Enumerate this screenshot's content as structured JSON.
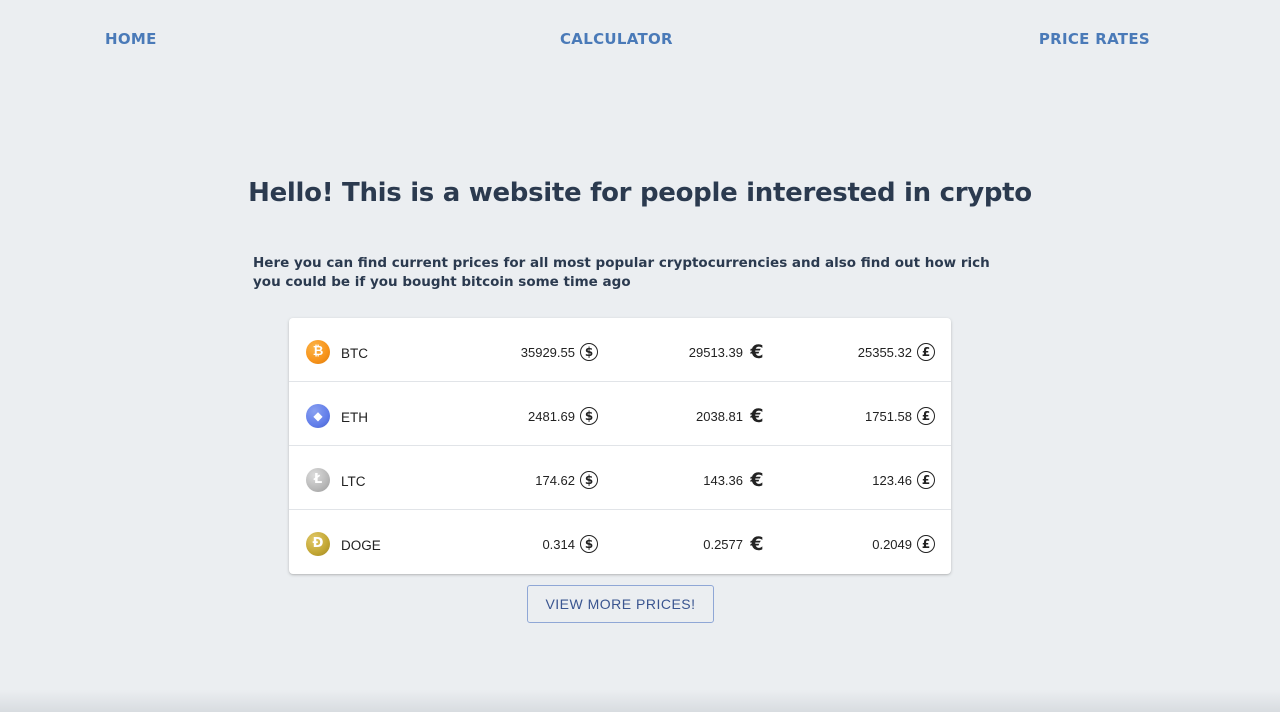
{
  "nav": {
    "home": "HOME",
    "calculator": "CALCULATOR",
    "price_rates": "PRICE RATES",
    "link_color": "#4a7ab8"
  },
  "main": {
    "headline": "Hello! This is a website for people interested in crypto",
    "intro": "Here you can find current prices for all most popular cryptocurrencies and also find out how rich you could be if you bought bitcoin some time ago"
  },
  "prices": {
    "rows": [
      {
        "symbol": "BTC",
        "icon": "bitcoin-icon",
        "icon_glyph": "₿",
        "icon_color": "#f7931a",
        "usd": "35929.55",
        "eur": "29513.39",
        "gbp": "25355.32"
      },
      {
        "symbol": "ETH",
        "icon": "ethereum-icon",
        "icon_glyph": "◆",
        "icon_color": "#627eea",
        "usd": "2481.69",
        "eur": "2038.81",
        "gbp": "1751.58"
      },
      {
        "symbol": "LTC",
        "icon": "litecoin-icon",
        "icon_glyph": "Ł",
        "icon_color": "#b8b8b8",
        "usd": "174.62",
        "eur": "143.36",
        "gbp": "123.46"
      },
      {
        "symbol": "DOGE",
        "icon": "dogecoin-icon",
        "icon_glyph": "Ð",
        "icon_color": "#c2a633",
        "usd": "0.314",
        "eur": "0.2577",
        "gbp": "0.2049"
      }
    ],
    "currency_icons": {
      "usd": "dollar-circle-icon",
      "eur": "euro-icon",
      "gbp": "pound-circle-icon"
    }
  },
  "actions": {
    "view_more": "VIEW MORE PRICES!"
  }
}
